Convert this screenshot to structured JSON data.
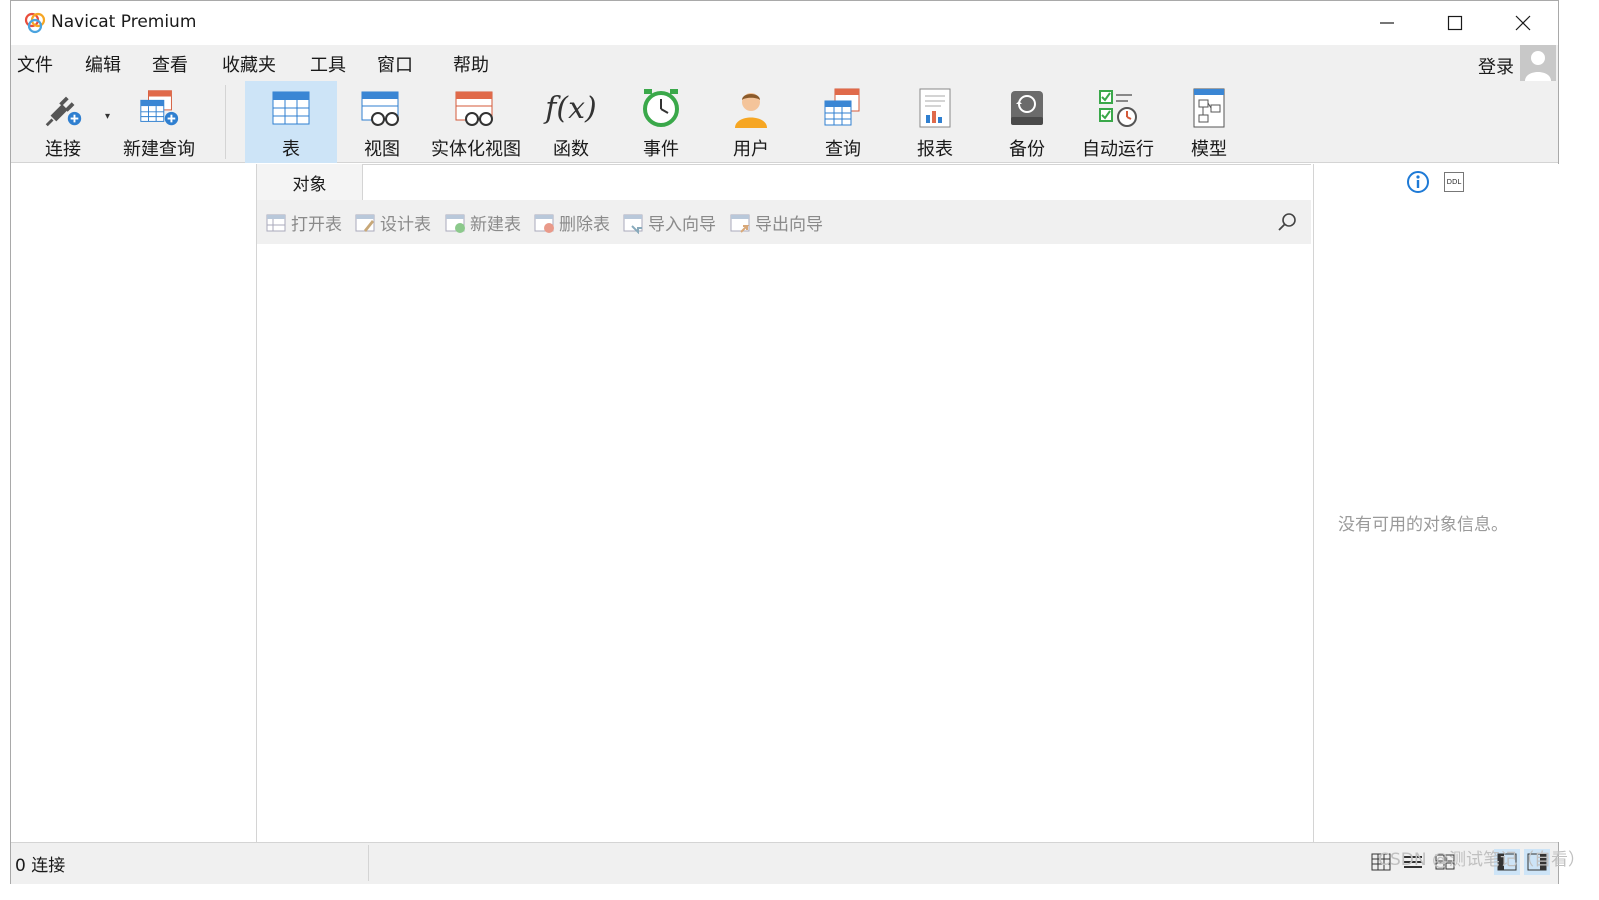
{
  "window": {
    "title": "Navicat Premium"
  },
  "menu": {
    "items": [
      "文件",
      "编辑",
      "查看",
      "收藏夹",
      "工具",
      "窗口",
      "帮助"
    ],
    "login": "登录"
  },
  "toolbar": {
    "items": [
      {
        "label": "连接",
        "icon": "plug-icon"
      },
      {
        "label": "新建查询",
        "icon": "new-query-icon"
      },
      {
        "label": "表",
        "icon": "table-icon",
        "active": true
      },
      {
        "label": "视图",
        "icon": "view-icon"
      },
      {
        "label": "实体化视图",
        "icon": "materialized-view-icon"
      },
      {
        "label": "函数",
        "icon": "function-icon"
      },
      {
        "label": "事件",
        "icon": "clock-icon"
      },
      {
        "label": "用户",
        "icon": "user-icon"
      },
      {
        "label": "查询",
        "icon": "query-icon"
      },
      {
        "label": "报表",
        "icon": "report-icon"
      },
      {
        "label": "备份",
        "icon": "backup-icon"
      },
      {
        "label": "自动运行",
        "icon": "automation-icon"
      },
      {
        "label": "模型",
        "icon": "model-icon"
      }
    ]
  },
  "tabs": {
    "objects": "对象"
  },
  "object_toolbar": {
    "buttons": [
      "打开表",
      "设计表",
      "新建表",
      "删除表",
      "导入向导",
      "导出向导"
    ]
  },
  "info_pane": {
    "empty_text": "没有可用的对象信息。"
  },
  "status": {
    "connections": "0 连接"
  },
  "watermark": "CSDN @测试笔记（自看）",
  "colors": {
    "accent": "#cde4f7",
    "toolbar_bg": "#f0f0f0",
    "info_blue": "#1e7ad6"
  }
}
